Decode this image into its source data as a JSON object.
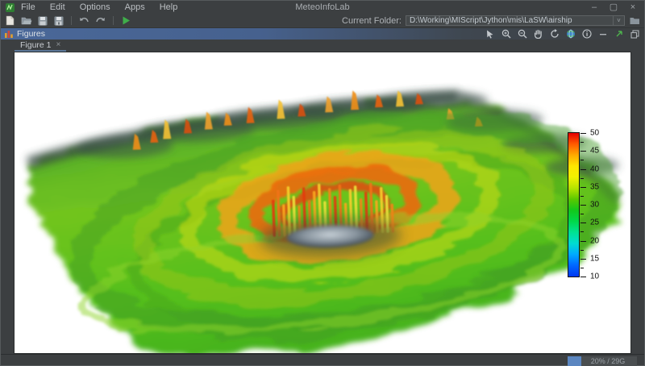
{
  "window": {
    "title": "MeteoInfoLab",
    "menus": [
      "File",
      "Edit",
      "Options",
      "Apps",
      "Help"
    ],
    "controls": [
      {
        "name": "minimize",
        "glyph": "–"
      },
      {
        "name": "maximize",
        "glyph": "▢"
      },
      {
        "name": "close",
        "glyph": "×"
      }
    ]
  },
  "toolbar": {
    "icons": [
      "new-script-icon",
      "open-file-icon",
      "save-icon",
      "save-as-icon",
      "undo-icon",
      "redo-icon",
      "run-script-icon"
    ],
    "current_folder_label": "Current Folder:",
    "current_folder_value": "D:\\Working\\MIScript\\Jython\\mis\\LaSW\\airship",
    "folder_chevron_glyph": "˅"
  },
  "figures_panel": {
    "title": "Figures",
    "header_icon": "bar-chart-icon",
    "tools": [
      "select-arrow-icon",
      "zoom-in-icon",
      "zoom-out-icon",
      "pan-hand-icon",
      "rotate-view-icon",
      "globe-icon",
      "info-icon",
      "minimize-panel-icon",
      "float-panel-icon",
      "restore-panel-icon"
    ],
    "tab": {
      "label": "Figure 1",
      "close_glyph": "×"
    }
  },
  "figure": {
    "description": "3D volume rendering of a typhoon: green spiral rain field, orange-red eyewall convection, dark central eye",
    "colorbar": {
      "min": 10,
      "max": 50,
      "ticks": [
        50,
        45,
        40,
        35,
        30,
        25,
        20,
        15,
        10
      ],
      "colors_top_to_bottom": [
        "#e40000",
        "#ff5a00",
        "#ffaa00",
        "#ffe600",
        "#f2f200",
        "#b4e400",
        "#5ac800",
        "#12c81c",
        "#00d84a",
        "#00e292",
        "#00dcd2",
        "#00aaff",
        "#0066ff",
        "#0038f0"
      ]
    }
  },
  "statusbar": {
    "memory_label": "20% / 29G",
    "memory_percent": 20
  }
}
